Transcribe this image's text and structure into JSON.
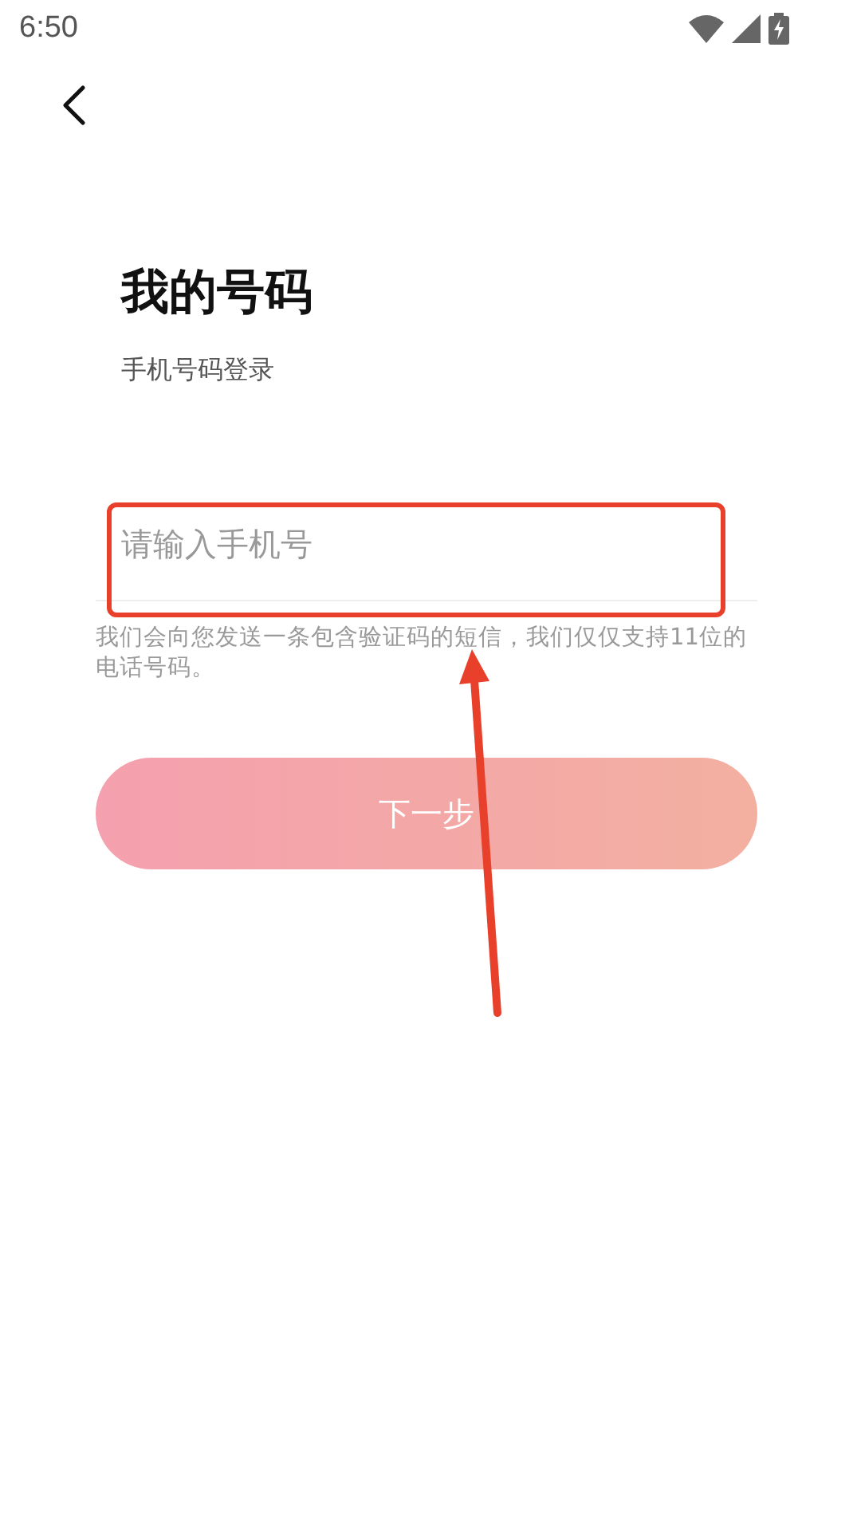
{
  "status_bar": {
    "time": "6:50"
  },
  "title": "我的号码",
  "subtitle": "手机号码登录",
  "phone_field": {
    "placeholder": "请输入手机号"
  },
  "hint": "我们会向您发送一条包含验证码的短信，我们仅仅支持11位的电话号码。",
  "next_button": {
    "label": "下一步",
    "disabled": true
  }
}
